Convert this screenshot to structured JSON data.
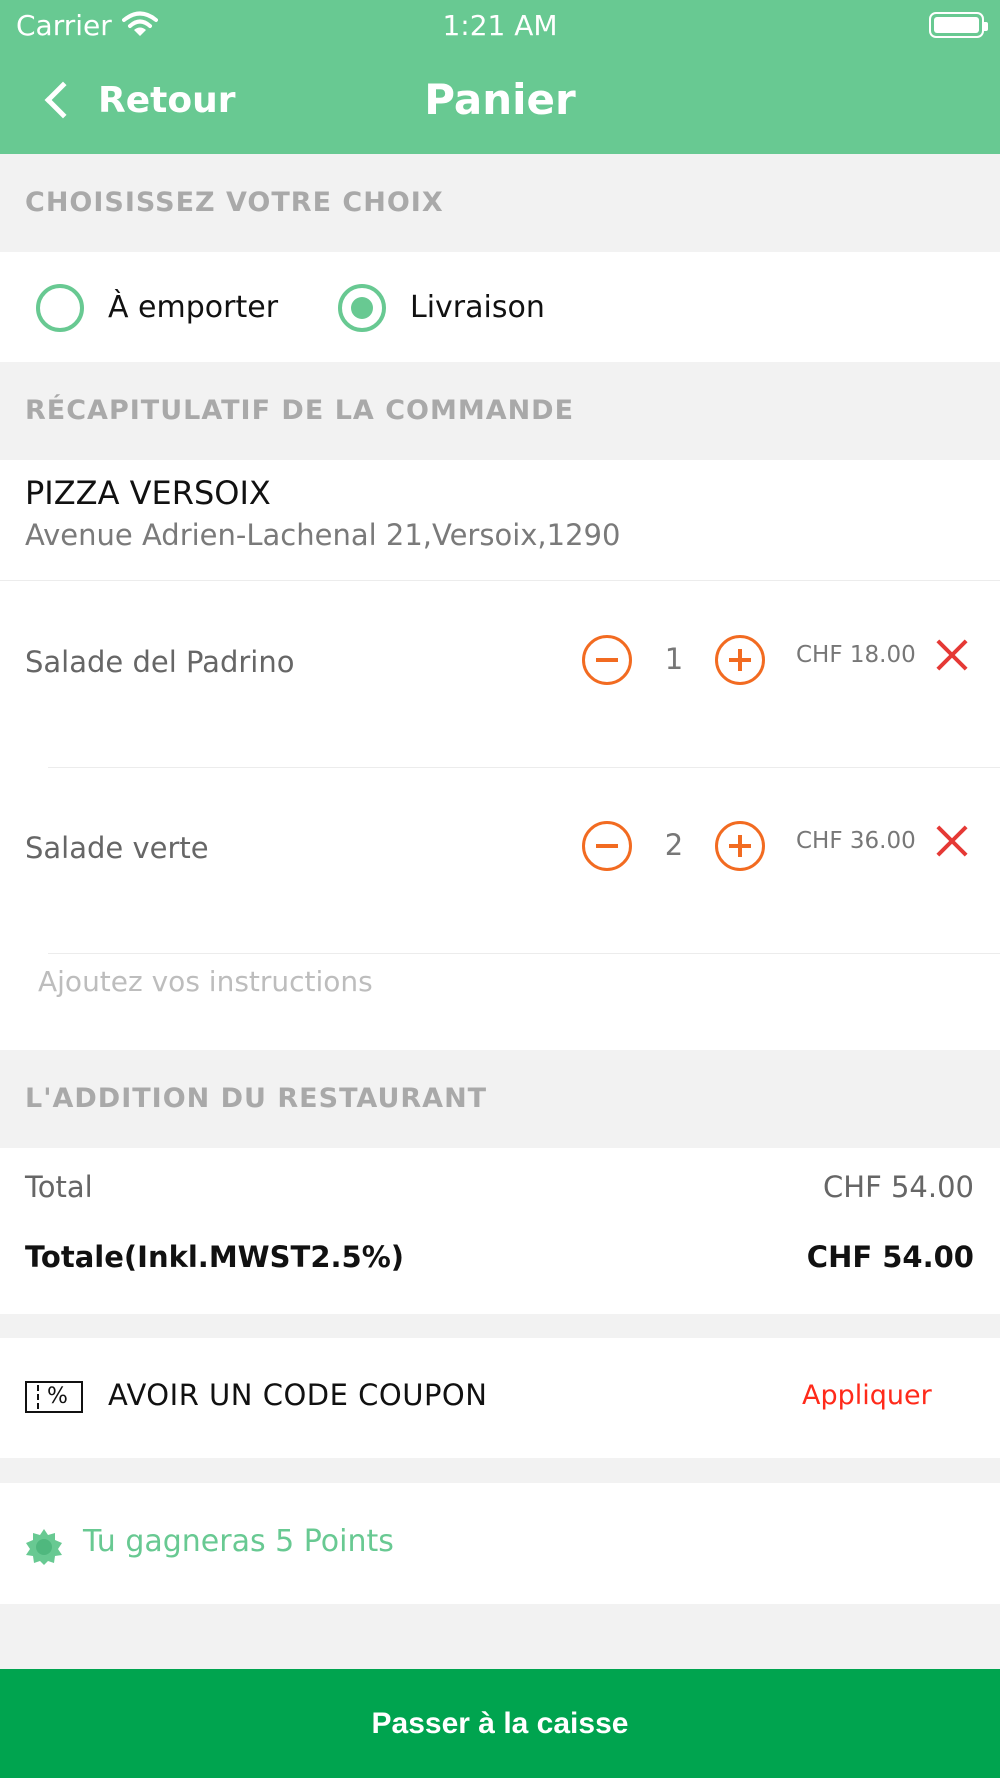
{
  "status_bar": {
    "carrier": "Carrier",
    "time": "1:21 AM"
  },
  "nav": {
    "back_label": "Retour",
    "title": "Panier"
  },
  "choice": {
    "header": "CHOISISSEZ VOTRE CHOIX",
    "options": [
      {
        "label": "À emporter",
        "selected": false
      },
      {
        "label": "Livraison",
        "selected": true
      }
    ]
  },
  "summary": {
    "header": "RÉCAPITULATIF DE LA COMMANDE",
    "restaurant_name": "PIZZA VERSOIX",
    "restaurant_address": "Avenue Adrien-Lachenal 21,Versoix,1290",
    "items": [
      {
        "name": "Salade del Padrino",
        "quantity": "1",
        "price": "CHF 18.00"
      },
      {
        "name": "Salade verte",
        "quantity": "2",
        "price": "CHF 36.00"
      }
    ],
    "instructions_placeholder": "Ajoutez vos instructions"
  },
  "bill": {
    "header": "L'ADDITION DU RESTAURANT",
    "total_label": "Total",
    "total_value": "CHF 54.00",
    "grand_total_label": "Totale(Inkl.MWST2.5%)",
    "grand_total_value": "CHF 54.00"
  },
  "coupon": {
    "label": "AVOIR UN CODE COUPON",
    "icon_text": "%",
    "apply_label": "Appliquer"
  },
  "points": {
    "label": "Tu gagneras 5 Points"
  },
  "checkout": {
    "label": "Passer à la caisse"
  },
  "colors": {
    "header": "#68c992",
    "accent_orange": "#f26b21",
    "remove_red": "#e53935",
    "checkout_green": "#00a44f"
  }
}
